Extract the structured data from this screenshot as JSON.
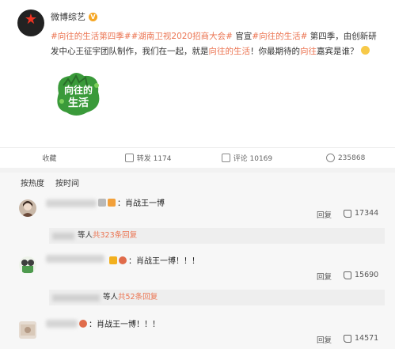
{
  "post": {
    "author": "微博综艺",
    "text_parts": [
      {
        "t": "#向往的生活第四季##湖南卫视2020招商大会#",
        "tag": true
      },
      {
        "t": " 官宣",
        "tag": false
      },
      {
        "t": "#向往的生活#",
        "tag": true
      },
      {
        "t": " 第四季，由创新研发中心王征宇团队制作，我们在一起，就是",
        "tag": false
      },
      {
        "t": "向往的生活",
        "tag": true
      },
      {
        "t": "！你最期待的",
        "tag": false
      },
      {
        "t": "向往",
        "tag": true
      },
      {
        "t": "嘉宾是谁？",
        "tag": false
      }
    ],
    "logo_text_top": "向往的",
    "logo_text_bottom": "生活"
  },
  "actions": {
    "collect": "收藏",
    "repost": "转发 1174",
    "comment": "评论 10169",
    "like": "235868"
  },
  "sort": {
    "hot": "按热度",
    "time": "按时间"
  },
  "comments": [
    {
      "text": "：肖战王一博",
      "reply": "回复",
      "likes": "17344",
      "sub_prefix": "等人",
      "sub_count": "共323条回复"
    },
    {
      "text": "：肖战王一博！！！",
      "reply": "回复",
      "likes": "15690",
      "sub_prefix": "等人",
      "sub_count": "共52条回复"
    },
    {
      "text": "：肖战王一博！！！",
      "reply": "回复",
      "likes": "14571"
    }
  ],
  "colors": {
    "accent": "#eb7350",
    "verified": "#f5a623",
    "comment_bg": "#f7f7f7"
  },
  "icons": [
    "star-icon",
    "verified-icon",
    "collect-icon",
    "repost-icon",
    "comment-icon",
    "like-icon",
    "thumb-up-icon"
  ]
}
